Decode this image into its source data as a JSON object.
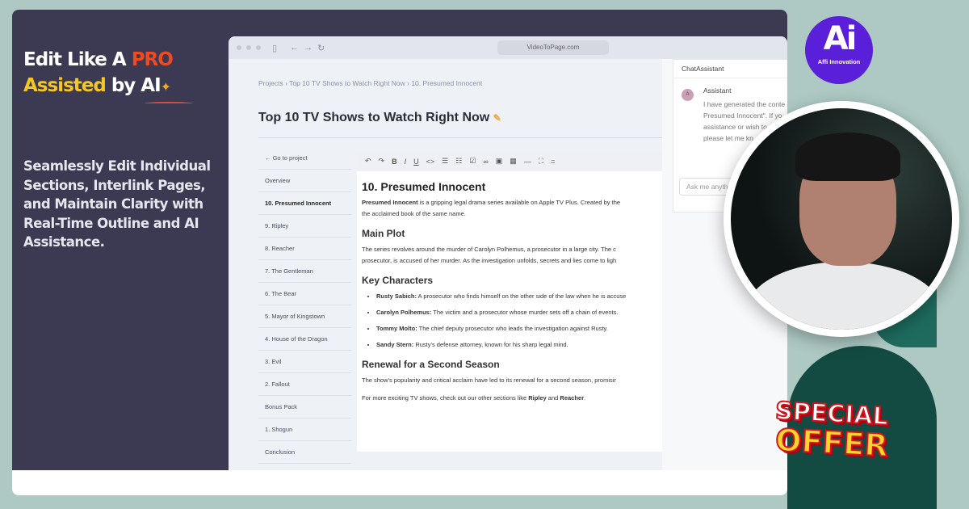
{
  "hero": {
    "line1_a": "Edit Like A ",
    "line1_b": "PRO",
    "line2_a": "Assisted",
    "line2_b": " by AI",
    "subtitle": "Seamlessly Edit Individual Sections, Interlink Pages, and Maintain Clarity with Real-Time Outline and AI Assistance."
  },
  "browser": {
    "url": "VideoToPage.com"
  },
  "breadcrumb": [
    "Projects",
    "Top 10 TV Shows to Watch Right Now",
    "10. Presumed Innocent"
  ],
  "page_title": "Top 10 TV Shows to Watch Right Now",
  "nav": {
    "back": "Go to project",
    "items": [
      "Overview",
      "10. Presumed Innocent",
      "9. Ripley",
      "8. Reacher",
      "7. The Gentleman",
      "6. The Bear",
      "5. Mayor of Kingstown",
      "4. House of the Dragon",
      "3. Evil",
      "2. Fallout",
      "Bonus Pack",
      "1. Shogun",
      "Conclusion"
    ],
    "active": "10. Presumed Innocent"
  },
  "toolbar": [
    "undo",
    "redo",
    "bold",
    "italic",
    "underline",
    "code",
    "bullet-list",
    "numbered-list",
    "task-list",
    "link",
    "image",
    "table",
    "horizontal-rule",
    "fullscreen",
    "align"
  ],
  "doc": {
    "h1": "10. Presumed Innocent",
    "intro_bold": "Presumed Innocent",
    "intro": " is a gripping legal drama series available on Apple TV Plus. Created by the",
    "intro2": "the acclaimed book of the same name.",
    "h_plot": "Main Plot",
    "plot1": "The series revolves around the murder of Carolyn Polhemus, a prosecutor in a large city. The c",
    "plot2": "prosecutor, is accused of her murder. As the investigation unfolds, secrets and lies come to ligh",
    "h_chars": "Key Characters",
    "chars": [
      {
        "name": "Rusty Sabich:",
        "desc": " A prosecutor who finds himself on the other side of the law when he is accuse"
      },
      {
        "name": "Carolyn Polhemus:",
        "desc": " The victim and a prosecutor whose murder sets off a chain of events."
      },
      {
        "name": "Tommy Molto:",
        "desc": " The chief deputy prosecutor who leads the investigation against Rusty."
      },
      {
        "name": "Sandy Stern:",
        "desc": " Rusty's defense attorney, known for his sharp legal mind."
      }
    ],
    "h_renewal": "Renewal for a Second Season",
    "renewal": "The show's popularity and critical acclaim have led to its renewal for a second season, promisir",
    "more_a": "For more exciting TV shows, check out our other sections like ",
    "more_b": "Ripley",
    "more_c": " and ",
    "more_d": "Reacher",
    "more_e": "."
  },
  "chat": {
    "title": "ChatAssistant",
    "avatar": "A",
    "author": "Assistant",
    "lines": [
      "I have generated the conte",
      "Presumed Innocent\". If yo",
      "assistance or wish to",
      "please let me kn"
    ],
    "placeholder": "Ask me anyth"
  },
  "logo": {
    "mark": "Ai",
    "name": "Affi Innovation"
  },
  "offer": {
    "line1": "SPECIAL",
    "line2": "OFFER"
  },
  "colors": {
    "accent_pro": "#ef4b23",
    "accent_assisted": "#f6c624",
    "panel": "#3b3a52",
    "background": "#aec9c4",
    "logo": "#5a1fd8",
    "arch": "#134b43"
  }
}
